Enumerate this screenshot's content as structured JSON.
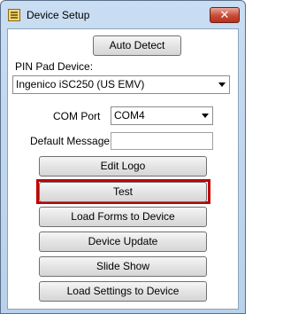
{
  "window": {
    "title": "Device Setup",
    "close_label": "✕"
  },
  "buttons": {
    "auto_detect": "Auto Detect",
    "edit_logo": "Edit Logo",
    "test": "Test",
    "load_forms": "Load Forms to Device",
    "device_update": "Device Update",
    "slide_show": "Slide Show",
    "load_settings": "Load Settings to Device"
  },
  "pinpad": {
    "label": "PIN Pad Device:",
    "selected": "Ingenico iSC250 (US EMV)"
  },
  "com_port": {
    "label": "COM Port",
    "selected": "COM4"
  },
  "default_message": {
    "label": "Default Message",
    "value": ""
  },
  "colors": {
    "highlight_outline": "#c00000"
  }
}
